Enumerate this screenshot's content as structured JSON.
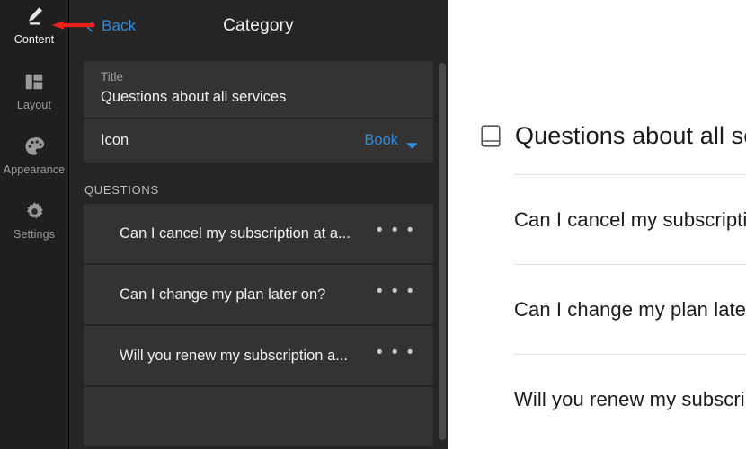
{
  "sidebar": {
    "items": [
      {
        "label": "Content",
        "icon": "pen-icon",
        "active": true
      },
      {
        "label": "Layout",
        "icon": "layout-icon",
        "active": false
      },
      {
        "label": "Appearance",
        "icon": "palette-icon",
        "active": false
      },
      {
        "label": "Settings",
        "icon": "gear-icon",
        "active": false
      }
    ]
  },
  "editor": {
    "back_label": "Back",
    "panel_title": "Category",
    "title_field": {
      "label": "Title",
      "value": "Questions about all services"
    },
    "icon_field": {
      "label": "Icon",
      "value": "Book"
    },
    "questions_section_label": "QUESTIONS",
    "questions": [
      {
        "text": "Can I cancel my subscription at a...",
        "menu": "• • •"
      },
      {
        "text": "Can I change my plan later on?",
        "menu": "• • •"
      },
      {
        "text": "Will you renew my subscription a...",
        "menu": "• • •"
      }
    ]
  },
  "preview": {
    "heading": "Questions about all services",
    "heading_icon": "book-icon",
    "rows": [
      {
        "text": "Can I cancel my subscription at any time?"
      },
      {
        "text": "Can I change my plan later on?"
      },
      {
        "text": "Will you renew my subscription automatically?"
      }
    ]
  },
  "annotation": {
    "arrow_color": "#e8211a",
    "direction": "left"
  },
  "colors": {
    "accent_blue": "#2f8ddb",
    "rail_bg": "#1f1f1f",
    "panel_bg": "#252526",
    "card_bg": "#333333",
    "preview_bg": "#ffffff"
  }
}
